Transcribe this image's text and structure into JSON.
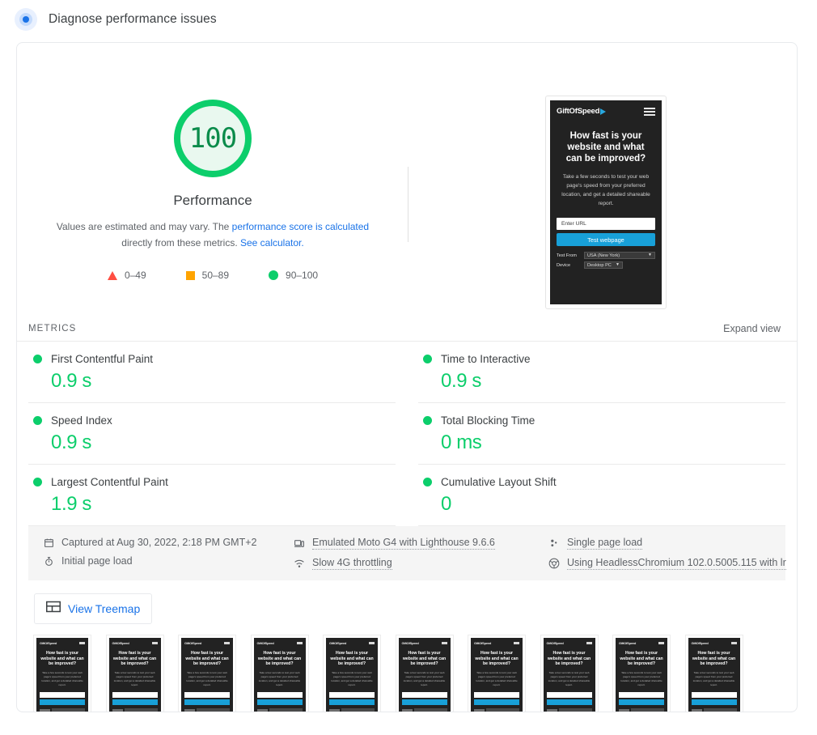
{
  "header": {
    "icon": "lighthouse-icon",
    "title": "Diagnose performance issues"
  },
  "score": {
    "value": "100",
    "category_label": "Performance",
    "ring_color": "#0cce6b",
    "fill_color": "#e9f8ef",
    "text_color": "#0b8c4b",
    "description_prefix": "Values are estimated and may vary. The ",
    "link_1": "performance score is calculated",
    "description_middle": " directly from these metrics. ",
    "link_2": "See calculator.",
    "legend": [
      {
        "shape": "triangle",
        "label": "0–49",
        "color": "#ff4e42"
      },
      {
        "shape": "square",
        "label": "50–89",
        "color": "#ffa400"
      },
      {
        "shape": "circle",
        "label": "90–100",
        "color": "#0cce6b"
      }
    ]
  },
  "screenshot_preview": {
    "brand": "GiftOfSpeed",
    "heading": "How fast is your website and what can be improved?",
    "subtext": "Take a few seconds to test your web page's speed from your preferred location, and get a detailed shareable report.",
    "url_input_placeholder": "Enter URL",
    "submit_label": "Test webpage",
    "test_from_label": "Test From",
    "test_from_value": "USA (New York)",
    "device_label": "Device",
    "device_value": "Desktop PC"
  },
  "metrics_section": {
    "caption": "METRICS",
    "expand_label": "Expand view",
    "items": [
      {
        "name": "First Contentful Paint",
        "value": "0.9 s",
        "status_color": "#0cce6b"
      },
      {
        "name": "Time to Interactive",
        "value": "0.9 s",
        "status_color": "#0cce6b"
      },
      {
        "name": "Speed Index",
        "value": "0.9 s",
        "status_color": "#0cce6b"
      },
      {
        "name": "Total Blocking Time",
        "value": "0 ms",
        "status_color": "#0cce6b"
      },
      {
        "name": "Largest Contentful Paint",
        "value": "1.9 s",
        "status_color": "#0cce6b"
      },
      {
        "name": "Cumulative Layout Shift",
        "value": "0",
        "status_color": "#0cce6b"
      }
    ]
  },
  "environment": {
    "captured_at": "Captured at Aug 30, 2022, 2:18 PM GMT+2",
    "page_load": "Initial page load",
    "emulation": "Emulated Moto G4 with Lighthouse 9.6.6",
    "throttling": "Slow 4G throttling",
    "load_type": "Single page load",
    "user_agent": "Using HeadlessChromium 102.0.5005.115 with lr"
  },
  "treemap": {
    "icon": "treemap-icon",
    "label": "View Treemap"
  },
  "filmstrip": {
    "frame_count": 10,
    "brand": "GiftOfSpeed",
    "heading": "How fast is your website and what can be improved?",
    "subtext": "Take a few seconds to test your web page's speed from your preferred location, and get a detailed shareable report."
  }
}
